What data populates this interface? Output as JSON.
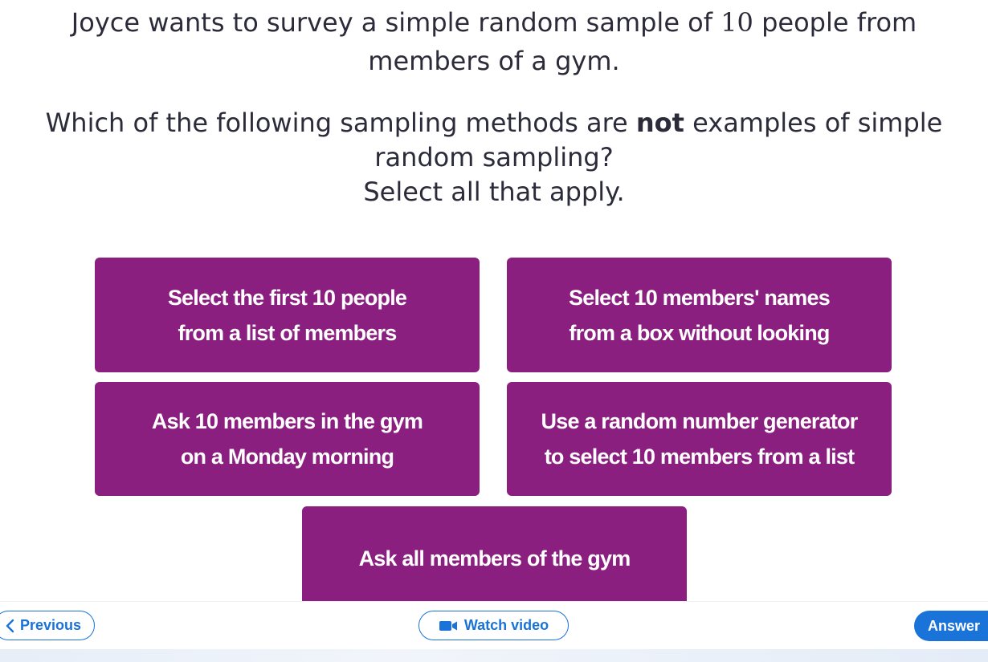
{
  "question": {
    "intro_before": "Joyce wants to survey a simple random sample of ",
    "intro_number": "10",
    "intro_after": " people from members of a gym.",
    "main_before": "Which of the following sampling methods are ",
    "main_bold": "not",
    "main_after": " examples of simple random sampling?",
    "instruction": "Select all that apply."
  },
  "options": [
    {
      "line1": "Select the first 10 people",
      "line2": "from a list of members"
    },
    {
      "line1": "Select 10 members' names",
      "line2": "from a box without looking"
    },
    {
      "line1": "Ask 10 members in the gym",
      "line2": "on a Monday morning"
    },
    {
      "line1": "Use a random number generator",
      "line2": "to select 10 members from a list"
    },
    {
      "line1": "Ask all members of the gym"
    }
  ],
  "footer": {
    "previous_label": "Previous",
    "video_label": "Watch video",
    "answer_label": "Answer"
  },
  "colors": {
    "option_bg": "#8b1f80",
    "accent_blue": "#1a73d9",
    "text": "#2b2b3a"
  },
  "icons": {
    "previous": "chevron-left-icon",
    "video": "video-camera-icon"
  }
}
